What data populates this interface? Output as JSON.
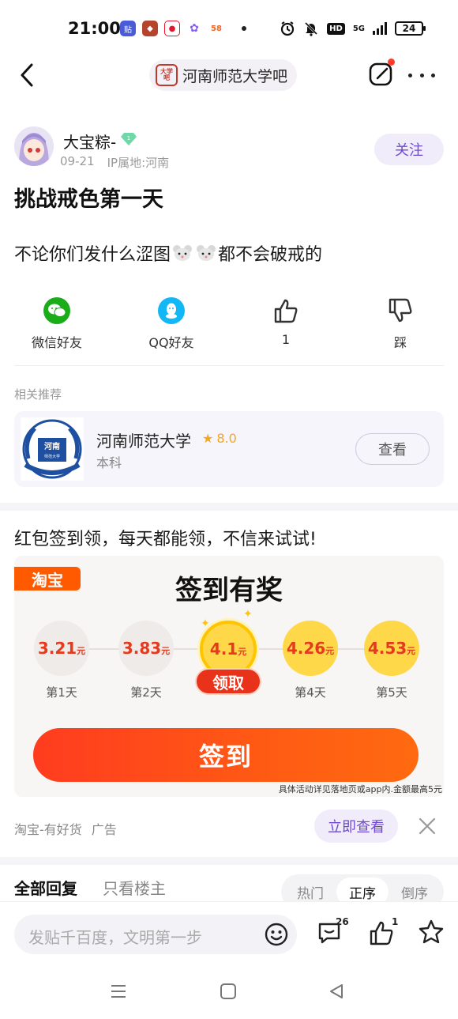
{
  "status_bar": {
    "time": "21:00",
    "notification_icons": [
      "tieba-icon",
      "game-icon",
      "weibo-icon",
      "app-icon",
      "58-icon"
    ],
    "battery": "24",
    "network": "5G",
    "hd": "HD"
  },
  "nav": {
    "forum_seal": "大学吧",
    "forum_name": "河南师范大学吧"
  },
  "author": {
    "name": "大宝粽-",
    "level": "1",
    "date": "09-21",
    "ip_location": "IP属地:河南",
    "follow_label": "关注"
  },
  "post": {
    "title": "挑战戒色第一天",
    "body_before": "不论你们发什么涩图",
    "body_after": "都不会破戒的"
  },
  "share": {
    "wechat_label": "微信好友",
    "qq_label": "QQ好友",
    "like_count": "1",
    "dislike_label": "踩"
  },
  "related": {
    "heading": "相关推荐",
    "logo_text": "河南",
    "logo_sub": "师范大学",
    "school_name": "河南师范大学",
    "rating": "8.0",
    "level": "本科",
    "view_label": "查看"
  },
  "ad": {
    "text": "红包签到领，每天都能领，不信来试试!",
    "brand_tag": "淘宝",
    "heading": "签到有奖",
    "days": [
      {
        "amount": "3.21",
        "unit": "元",
        "label": "第1天",
        "style": "gray"
      },
      {
        "amount": "3.83",
        "unit": "元",
        "label": "第2天",
        "style": "gray"
      },
      {
        "amount": "4.1",
        "unit": "元",
        "label": "",
        "style": "big"
      },
      {
        "amount": "4.26",
        "unit": "元",
        "label": "第4天",
        "style": "gold"
      },
      {
        "amount": "4.53",
        "unit": "元",
        "label": "第5天",
        "style": "gold"
      }
    ],
    "claim_label": "领取",
    "signin_label": "签到",
    "fine_print": "具体活动详见落地页或app内.金额最高5元",
    "source": "淘宝-有好货",
    "ad_tag": "广告",
    "cta": "立即查看"
  },
  "replies": {
    "tab_all": "全部回复",
    "tab_op": "只看楼主",
    "sort_hot": "热门",
    "sort_asc": "正序",
    "sort_desc": "倒序"
  },
  "composer": {
    "placeholder": "发贴千百度，文明第一步",
    "comment_count": "26",
    "like_count": "1"
  },
  "colors": {
    "accent_purple": "#6f4ad1",
    "taobao_orange": "#ff5a00",
    "signin_red": "#ff3c1f",
    "wechat_green": "#1aad19",
    "qq_blue": "#12b7f5"
  }
}
